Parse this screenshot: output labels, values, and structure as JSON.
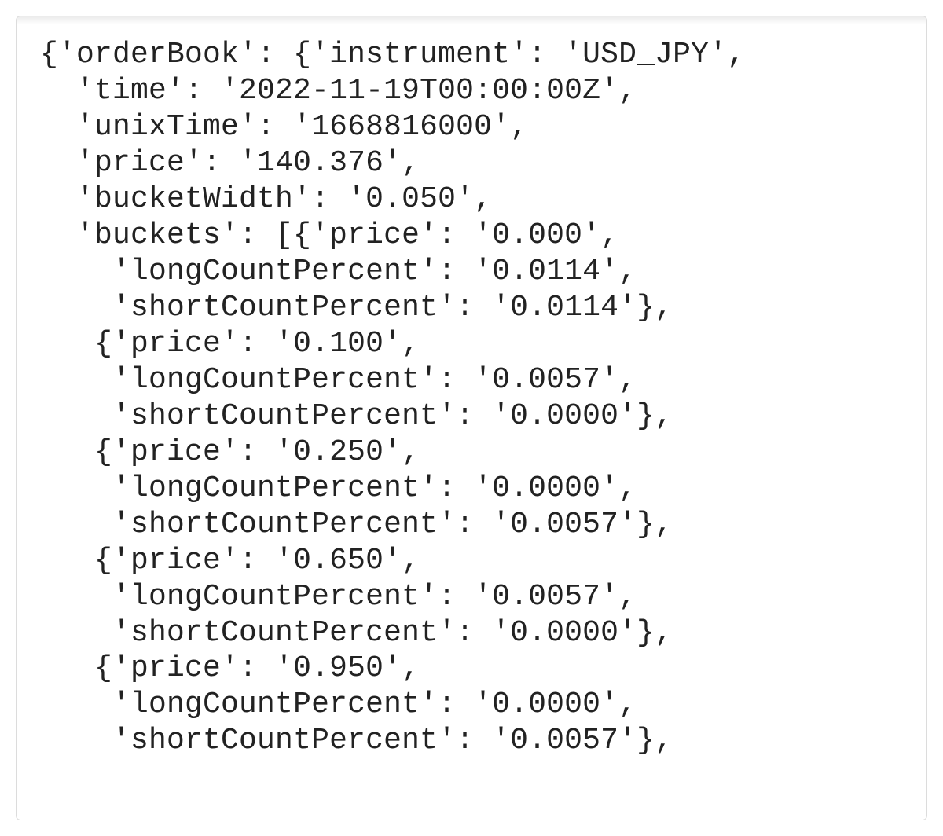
{
  "orderBook": {
    "root_key": "orderBook",
    "instrument_key": "instrument",
    "instrument": "USD_JPY",
    "time_key": "time",
    "time": "2022-11-19T00:00:00Z",
    "unixTime_key": "unixTime",
    "unixTime": "1668816000",
    "price_key": "price",
    "price": "140.376",
    "bucketWidth_key": "bucketWidth",
    "bucketWidth": "0.050",
    "buckets_key": "buckets",
    "bucket_price_key": "price",
    "long_key": "longCountPercent",
    "short_key": "shortCountPercent",
    "buckets": [
      {
        "price": "0.000",
        "longCountPercent": "0.0114",
        "shortCountPercent": "0.0114"
      },
      {
        "price": "0.100",
        "longCountPercent": "0.0057",
        "shortCountPercent": "0.0000"
      },
      {
        "price": "0.250",
        "longCountPercent": "0.0000",
        "shortCountPercent": "0.0057"
      },
      {
        "price": "0.650",
        "longCountPercent": "0.0057",
        "shortCountPercent": "0.0000"
      },
      {
        "price": "0.950",
        "longCountPercent": "0.0000",
        "shortCountPercent": "0.0057"
      }
    ]
  }
}
